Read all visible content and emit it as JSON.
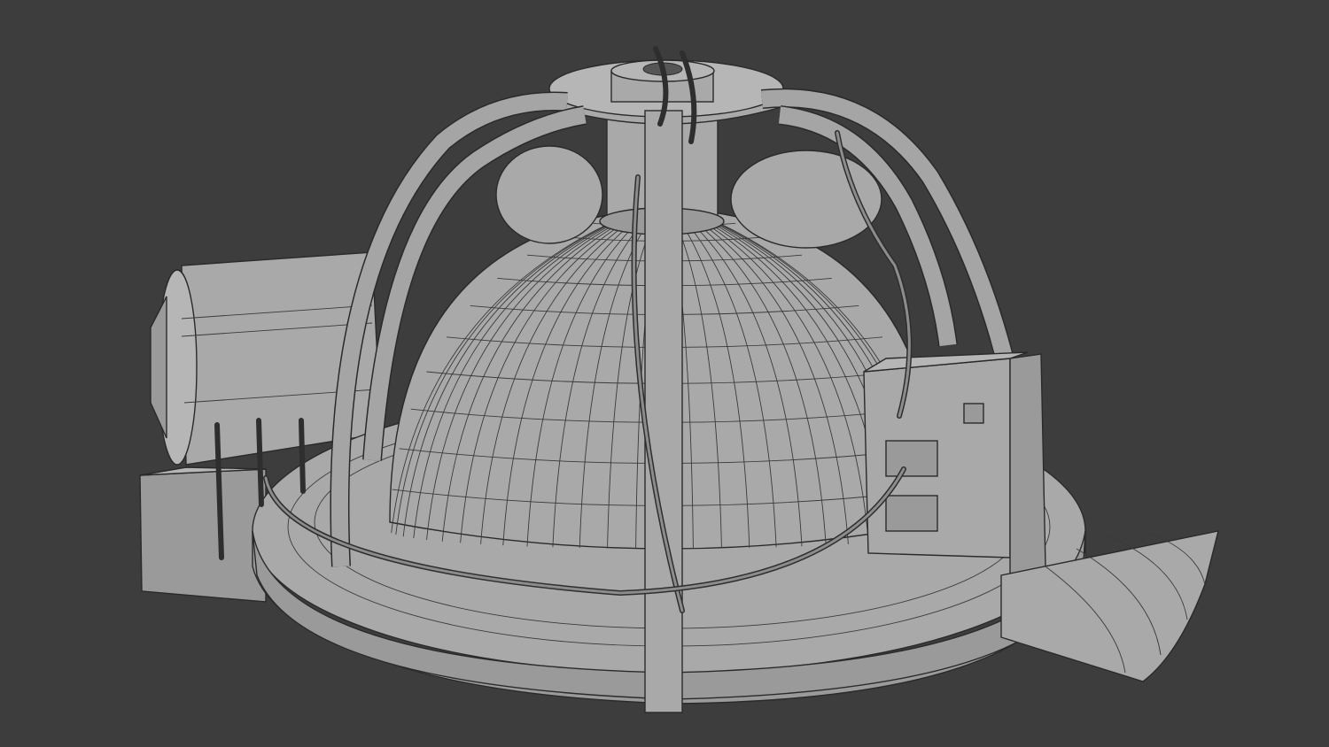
{
  "scene": {
    "background_color": "#3d3d3d",
    "model_color": "#a9a9a9",
    "wire_color": "#2a2a2a",
    "parts": [
      "base-platform",
      "dome",
      "top-column",
      "arches",
      "side-cylinder",
      "control-box",
      "stairs",
      "cables"
    ]
  }
}
